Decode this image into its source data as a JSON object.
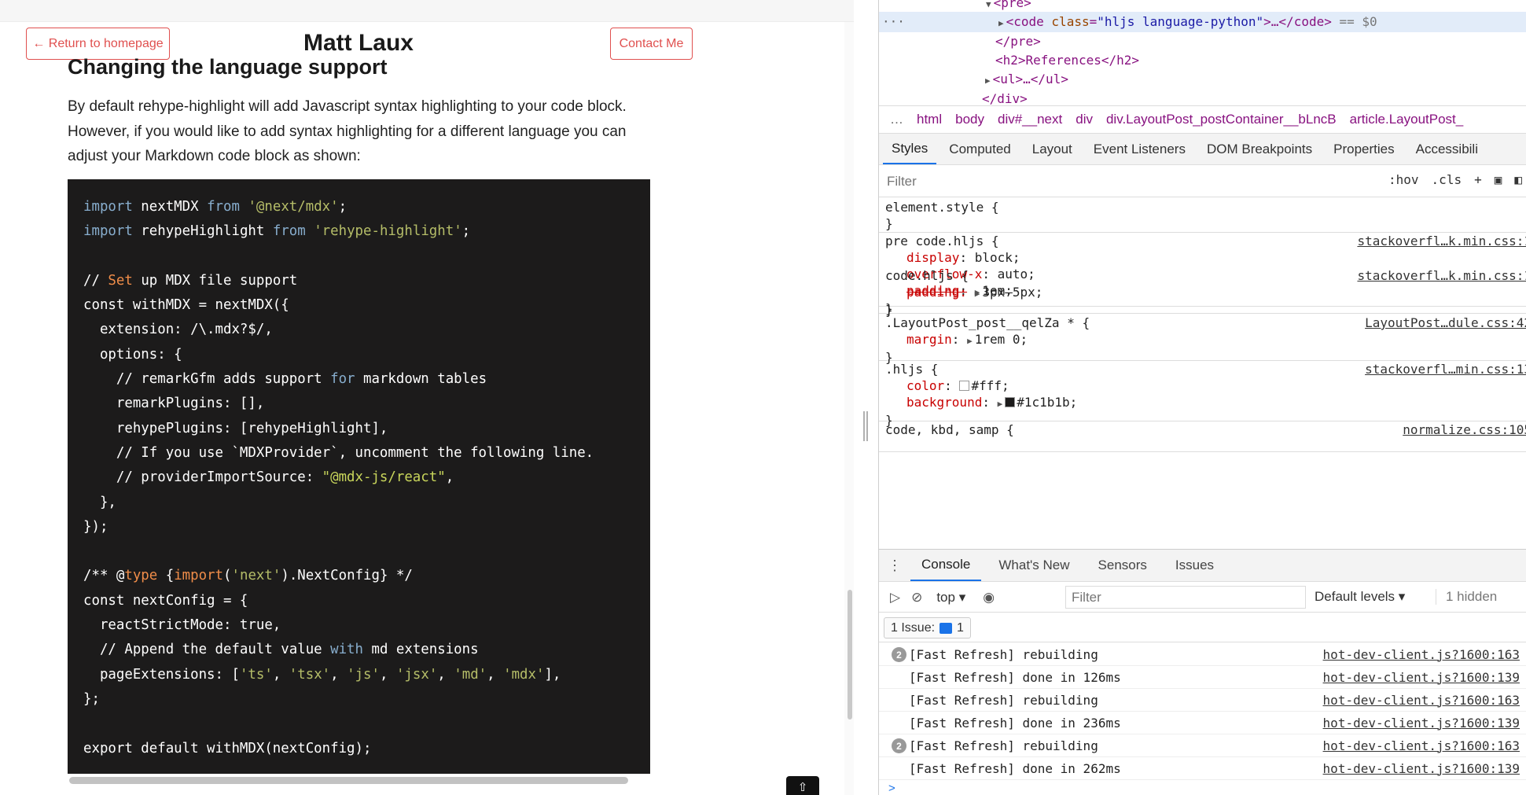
{
  "page": {
    "back_label": "← Return to homepage",
    "site_title": "Matt Laux",
    "contact_label": "Contact Me",
    "heading": "Changing the language support",
    "paragraph": "By default rehype-highlight will add Javascript syntax highlighting to your code block. However, if you would like to add syntax highlighting for a different language you can adjust your Markdown code block as shown:",
    "code": [
      [
        [
          "import",
          "k"
        ],
        [
          " nextMDX ",
          ""
        ],
        [
          "from",
          "k"
        ],
        [
          " ",
          ""
        ],
        [
          "'@next/mdx'",
          "s"
        ],
        [
          ";",
          ""
        ]
      ],
      [
        [
          "import",
          "k"
        ],
        [
          " rehypeHighlight ",
          ""
        ],
        [
          "from",
          "k"
        ],
        [
          " ",
          ""
        ],
        [
          "'rehype-highlight'",
          "s"
        ],
        [
          ";",
          ""
        ]
      ],
      [
        [
          "",
          ""
        ]
      ],
      [
        [
          "// ",
          ""
        ],
        [
          "Set",
          "o"
        ],
        [
          " up MDX file support",
          ""
        ]
      ],
      [
        [
          "const withMDX = nextMDX({",
          ""
        ]
      ],
      [
        [
          "  extension: /\\.mdx?$/,",
          ""
        ]
      ],
      [
        [
          "  options: {",
          ""
        ]
      ],
      [
        [
          "    // remarkGfm adds support ",
          ""
        ],
        [
          "for",
          "k"
        ],
        [
          " markdown tables",
          ""
        ]
      ],
      [
        [
          "    remarkPlugins: [],",
          ""
        ]
      ],
      [
        [
          "    rehypePlugins: [rehypeHighlight],",
          ""
        ]
      ],
      [
        [
          "    // If you use `MDXProvider`, uncomment the following line.",
          ""
        ]
      ],
      [
        [
          "    // providerImportSource: ",
          ""
        ],
        [
          "\"@mdx-js/react\"",
          "sc"
        ],
        [
          ",",
          ""
        ]
      ],
      [
        [
          "  },",
          ""
        ]
      ],
      [
        [
          "});",
          ""
        ]
      ],
      [
        [
          "",
          ""
        ]
      ],
      [
        [
          "/** @",
          ""
        ],
        [
          "type",
          "o"
        ],
        [
          " {",
          ""
        ],
        [
          "import",
          "o"
        ],
        [
          "(",
          ""
        ],
        [
          "'next'",
          "s"
        ],
        [
          ").NextConfig} */",
          ""
        ]
      ],
      [
        [
          "const nextConfig = {",
          ""
        ]
      ],
      [
        [
          "  reactStrictMode: true,",
          ""
        ]
      ],
      [
        [
          "  // Append the default value ",
          ""
        ],
        [
          "with",
          "k"
        ],
        [
          " md extensions",
          ""
        ]
      ],
      [
        [
          "  pageExtensions: [",
          ""
        ],
        [
          "'ts'",
          "s"
        ],
        [
          ", ",
          ""
        ],
        [
          "'tsx'",
          "s"
        ],
        [
          ", ",
          ""
        ],
        [
          "'js'",
          "s"
        ],
        [
          ", ",
          ""
        ],
        [
          "'jsx'",
          "s"
        ],
        [
          ", ",
          ""
        ],
        [
          "'md'",
          "s"
        ],
        [
          ", ",
          ""
        ],
        [
          "'mdx'",
          "s"
        ],
        [
          "],",
          ""
        ]
      ],
      [
        [
          "};",
          ""
        ]
      ],
      [
        [
          "",
          ""
        ]
      ],
      [
        [
          "export default withMDX(nextConfig);",
          ""
        ]
      ]
    ],
    "top_button_icon": "arrow-up-icon"
  },
  "devtools": {
    "dom": {
      "line_pre_open": "<pre>",
      "selected_tag": "<code ",
      "selected_attr": "class",
      "selected_value": "\"hljs language-python\"",
      "selected_rest": ">…</code>",
      "selected_marker": "== $0",
      "dots": "···",
      "line_pre_close": "</pre>",
      "line_h2": "<h2>References</h2>",
      "line_ul": "<ul>…</ul>",
      "line_div_close": "</div>"
    },
    "breadcrumbs": [
      "…",
      "html",
      "body",
      "div#__next",
      "div",
      "div.LayoutPost_postContainer__bLncB",
      "article.LayoutPost_"
    ],
    "style_tabs": [
      "Styles",
      "Computed",
      "Layout",
      "Event Listeners",
      "DOM Breakpoints",
      "Properties",
      "Accessibili"
    ],
    "filter_placeholder": "Filter",
    "filter_tools": [
      ":hov",
      ".cls",
      "+"
    ],
    "rules": [
      {
        "selector": "element.style {",
        "source": "",
        "props": []
      },
      {
        "selector": "pre code.hljs {",
        "source": "stackoverfl…k.min.css:1",
        "props": [
          {
            "name": "display",
            "value": "block;"
          },
          {
            "name": "overflow-x",
            "value": "auto;"
          },
          {
            "name": "padding",
            "value": "1em;"
          }
        ]
      },
      {
        "selector": "code.hljs {",
        "source": "stackoverfl…k.min.css:1",
        "props": [
          {
            "name": "padding:",
            "value": "3px–5px;"
          }
        ]
      },
      {
        "selector": ".LayoutPost_post__qelZa * {",
        "source": "LayoutPost…dule.css:42",
        "props": [
          {
            "name": "margin",
            "value": "1rem 0;"
          }
        ]
      },
      {
        "selector": ".hljs {",
        "source": "stackoverfl…min.css:13",
        "props": [
          {
            "name": "color",
            "value": "#fff;"
          },
          {
            "name": "background",
            "value": "#1c1b1b;"
          }
        ]
      },
      {
        "selector": "code, kbd, samp {",
        "source": "normalize.css:105",
        "props": []
      }
    ],
    "drawer_tabs": [
      "Console",
      "What's New",
      "Sensors",
      "Issues"
    ],
    "console": {
      "context": "top",
      "filter_placeholder": "Filter",
      "levels": "Default levels",
      "hidden": "1 hidden",
      "issues_label": "1 Issue:",
      "issues_count": "1",
      "logs": [
        {
          "count": "2",
          "msg": "[Fast Refresh] rebuilding",
          "src": "hot-dev-client.js?1600:163"
        },
        {
          "count": "",
          "msg": "[Fast Refresh] done in 126ms",
          "src": "hot-dev-client.js?1600:139"
        },
        {
          "count": "",
          "msg": "[Fast Refresh] rebuilding",
          "src": "hot-dev-client.js?1600:163"
        },
        {
          "count": "",
          "msg": "[Fast Refresh] done in 236ms",
          "src": "hot-dev-client.js?1600:139"
        },
        {
          "count": "2",
          "msg": "[Fast Refresh] rebuilding",
          "src": "hot-dev-client.js?1600:163"
        },
        {
          "count": "",
          "msg": "[Fast Refresh] done in 262ms",
          "src": "hot-dev-client.js?1600:139"
        }
      ],
      "prompt": ">"
    },
    "colors": {
      "accent": "#1a73e8",
      "brand_red": "#e0504f",
      "code_bg": "#1c1b1b"
    }
  }
}
